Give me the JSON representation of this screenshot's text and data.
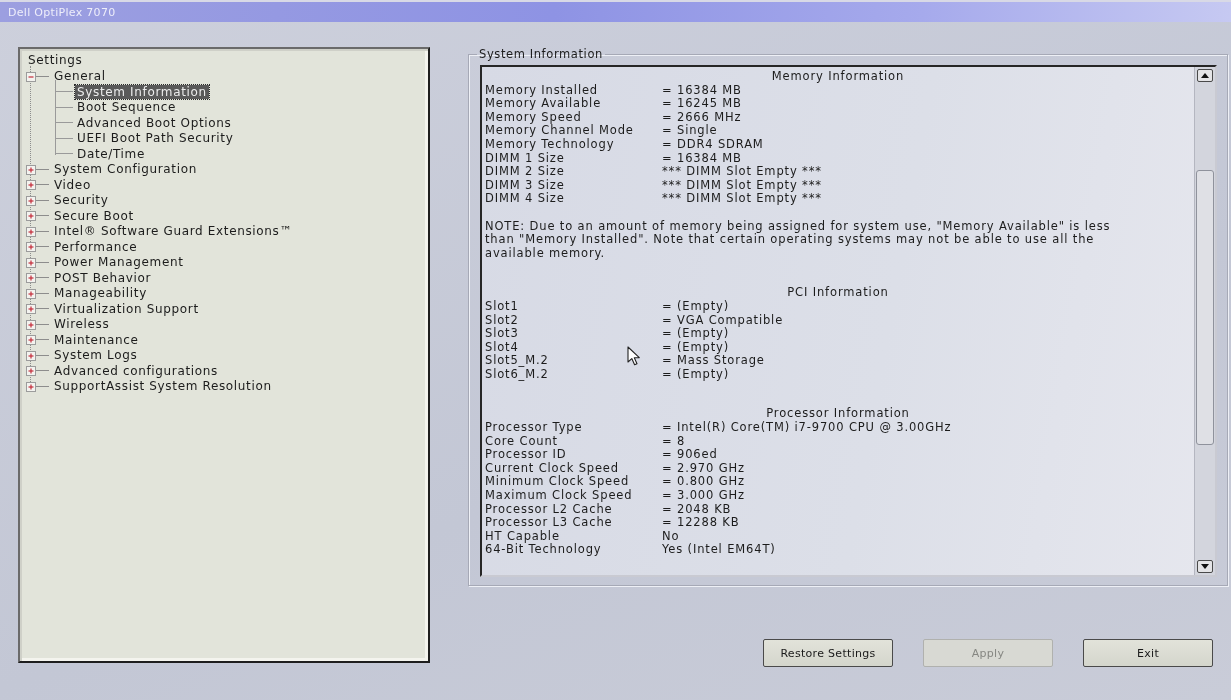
{
  "window": {
    "title": "Dell OptiPlex 7070"
  },
  "tree": {
    "title": "Settings",
    "items": [
      {
        "label": "General",
        "expanded": true,
        "selected": false,
        "children": [
          {
            "label": "System Information",
            "selected": true
          },
          {
            "label": "Boot Sequence",
            "selected": false
          },
          {
            "label": "Advanced Boot Options",
            "selected": false
          },
          {
            "label": "UEFI Boot Path Security",
            "selected": false
          },
          {
            "label": "Date/Time",
            "selected": false
          }
        ]
      },
      {
        "label": "System Configuration",
        "expanded": false,
        "selected": false
      },
      {
        "label": "Video",
        "expanded": false,
        "selected": false
      },
      {
        "label": "Security",
        "expanded": false,
        "selected": false
      },
      {
        "label": "Secure Boot",
        "expanded": false,
        "selected": false
      },
      {
        "label": "Intel® Software Guard Extensions™",
        "expanded": false,
        "selected": false
      },
      {
        "label": "Performance",
        "expanded": false,
        "selected": false
      },
      {
        "label": "Power Management",
        "expanded": false,
        "selected": false
      },
      {
        "label": "POST Behavior",
        "expanded": false,
        "selected": false
      },
      {
        "label": "Manageability",
        "expanded": false,
        "selected": false
      },
      {
        "label": "Virtualization Support",
        "expanded": false,
        "selected": false
      },
      {
        "label": "Wireless",
        "expanded": false,
        "selected": false
      },
      {
        "label": "Maintenance",
        "expanded": false,
        "selected": false
      },
      {
        "label": "System Logs",
        "expanded": false,
        "selected": false
      },
      {
        "label": "Advanced configurations",
        "expanded": false,
        "selected": false
      },
      {
        "label": "SupportAssist System Resolution",
        "expanded": false,
        "selected": false
      }
    ]
  },
  "details": {
    "title": "System Information",
    "sections": [
      {
        "title": "Memory Information",
        "rows": [
          {
            "label": "Memory Installed",
            "value": "= 16384 MB"
          },
          {
            "label": "Memory Available",
            "value": "= 16245 MB"
          },
          {
            "label": "Memory Speed",
            "value": "= 2666 MHz"
          },
          {
            "label": "Memory Channel Mode",
            "value": "= Single"
          },
          {
            "label": "Memory Technology",
            "value": "= DDR4 SDRAM"
          },
          {
            "label": "DIMM 1 Size",
            "value": "= 16384 MB"
          },
          {
            "label": "DIMM 2 Size",
            "value": "*** DIMM Slot Empty ***"
          },
          {
            "label": "DIMM 3 Size",
            "value": "*** DIMM Slot Empty ***"
          },
          {
            "label": "DIMM 4 Size",
            "value": "*** DIMM Slot Empty ***"
          }
        ],
        "note": "NOTE: Due to an amount of memory being assigned for system use, \"Memory Available\" is less than \"Memory Installed\". Note that certain operating systems may not be able to use all the available memory."
      },
      {
        "title": "PCI Information",
        "rows": [
          {
            "label": "Slot1",
            "value": "= (Empty)"
          },
          {
            "label": "Slot2",
            "value": "= VGA Compatible"
          },
          {
            "label": "Slot3",
            "value": "= (Empty)"
          },
          {
            "label": "Slot4",
            "value": "= (Empty)"
          },
          {
            "label": "Slot5_M.2",
            "value": "= Mass Storage"
          },
          {
            "label": "Slot6_M.2",
            "value": "= (Empty)"
          }
        ]
      },
      {
        "title": "Processor Information",
        "rows": [
          {
            "label": "Processor Type",
            "value": "= Intel(R) Core(TM) i7-9700 CPU @ 3.00GHz"
          },
          {
            "label": "Core Count",
            "value": "= 8"
          },
          {
            "label": "Processor ID",
            "value": "= 906ed"
          },
          {
            "label": "Current Clock Speed",
            "value": "= 2.970 GHz"
          },
          {
            "label": "Minimum Clock Speed",
            "value": "= 0.800 GHz"
          },
          {
            "label": "Maximum Clock Speed",
            "value": "= 3.000 GHz"
          },
          {
            "label": "Processor L2 Cache",
            "value": "= 2048 KB"
          },
          {
            "label": "Processor L3 Cache",
            "value": "= 12288 KB"
          },
          {
            "label": "HT Capable",
            "value": "No"
          },
          {
            "label": "64-Bit Technology",
            "value": "Yes (Intel EM64T)"
          }
        ]
      }
    ]
  },
  "buttons": [
    {
      "label": "Restore Settings",
      "disabled": false
    },
    {
      "label": "Apply",
      "disabled": true
    },
    {
      "label": "Exit",
      "disabled": false
    }
  ]
}
